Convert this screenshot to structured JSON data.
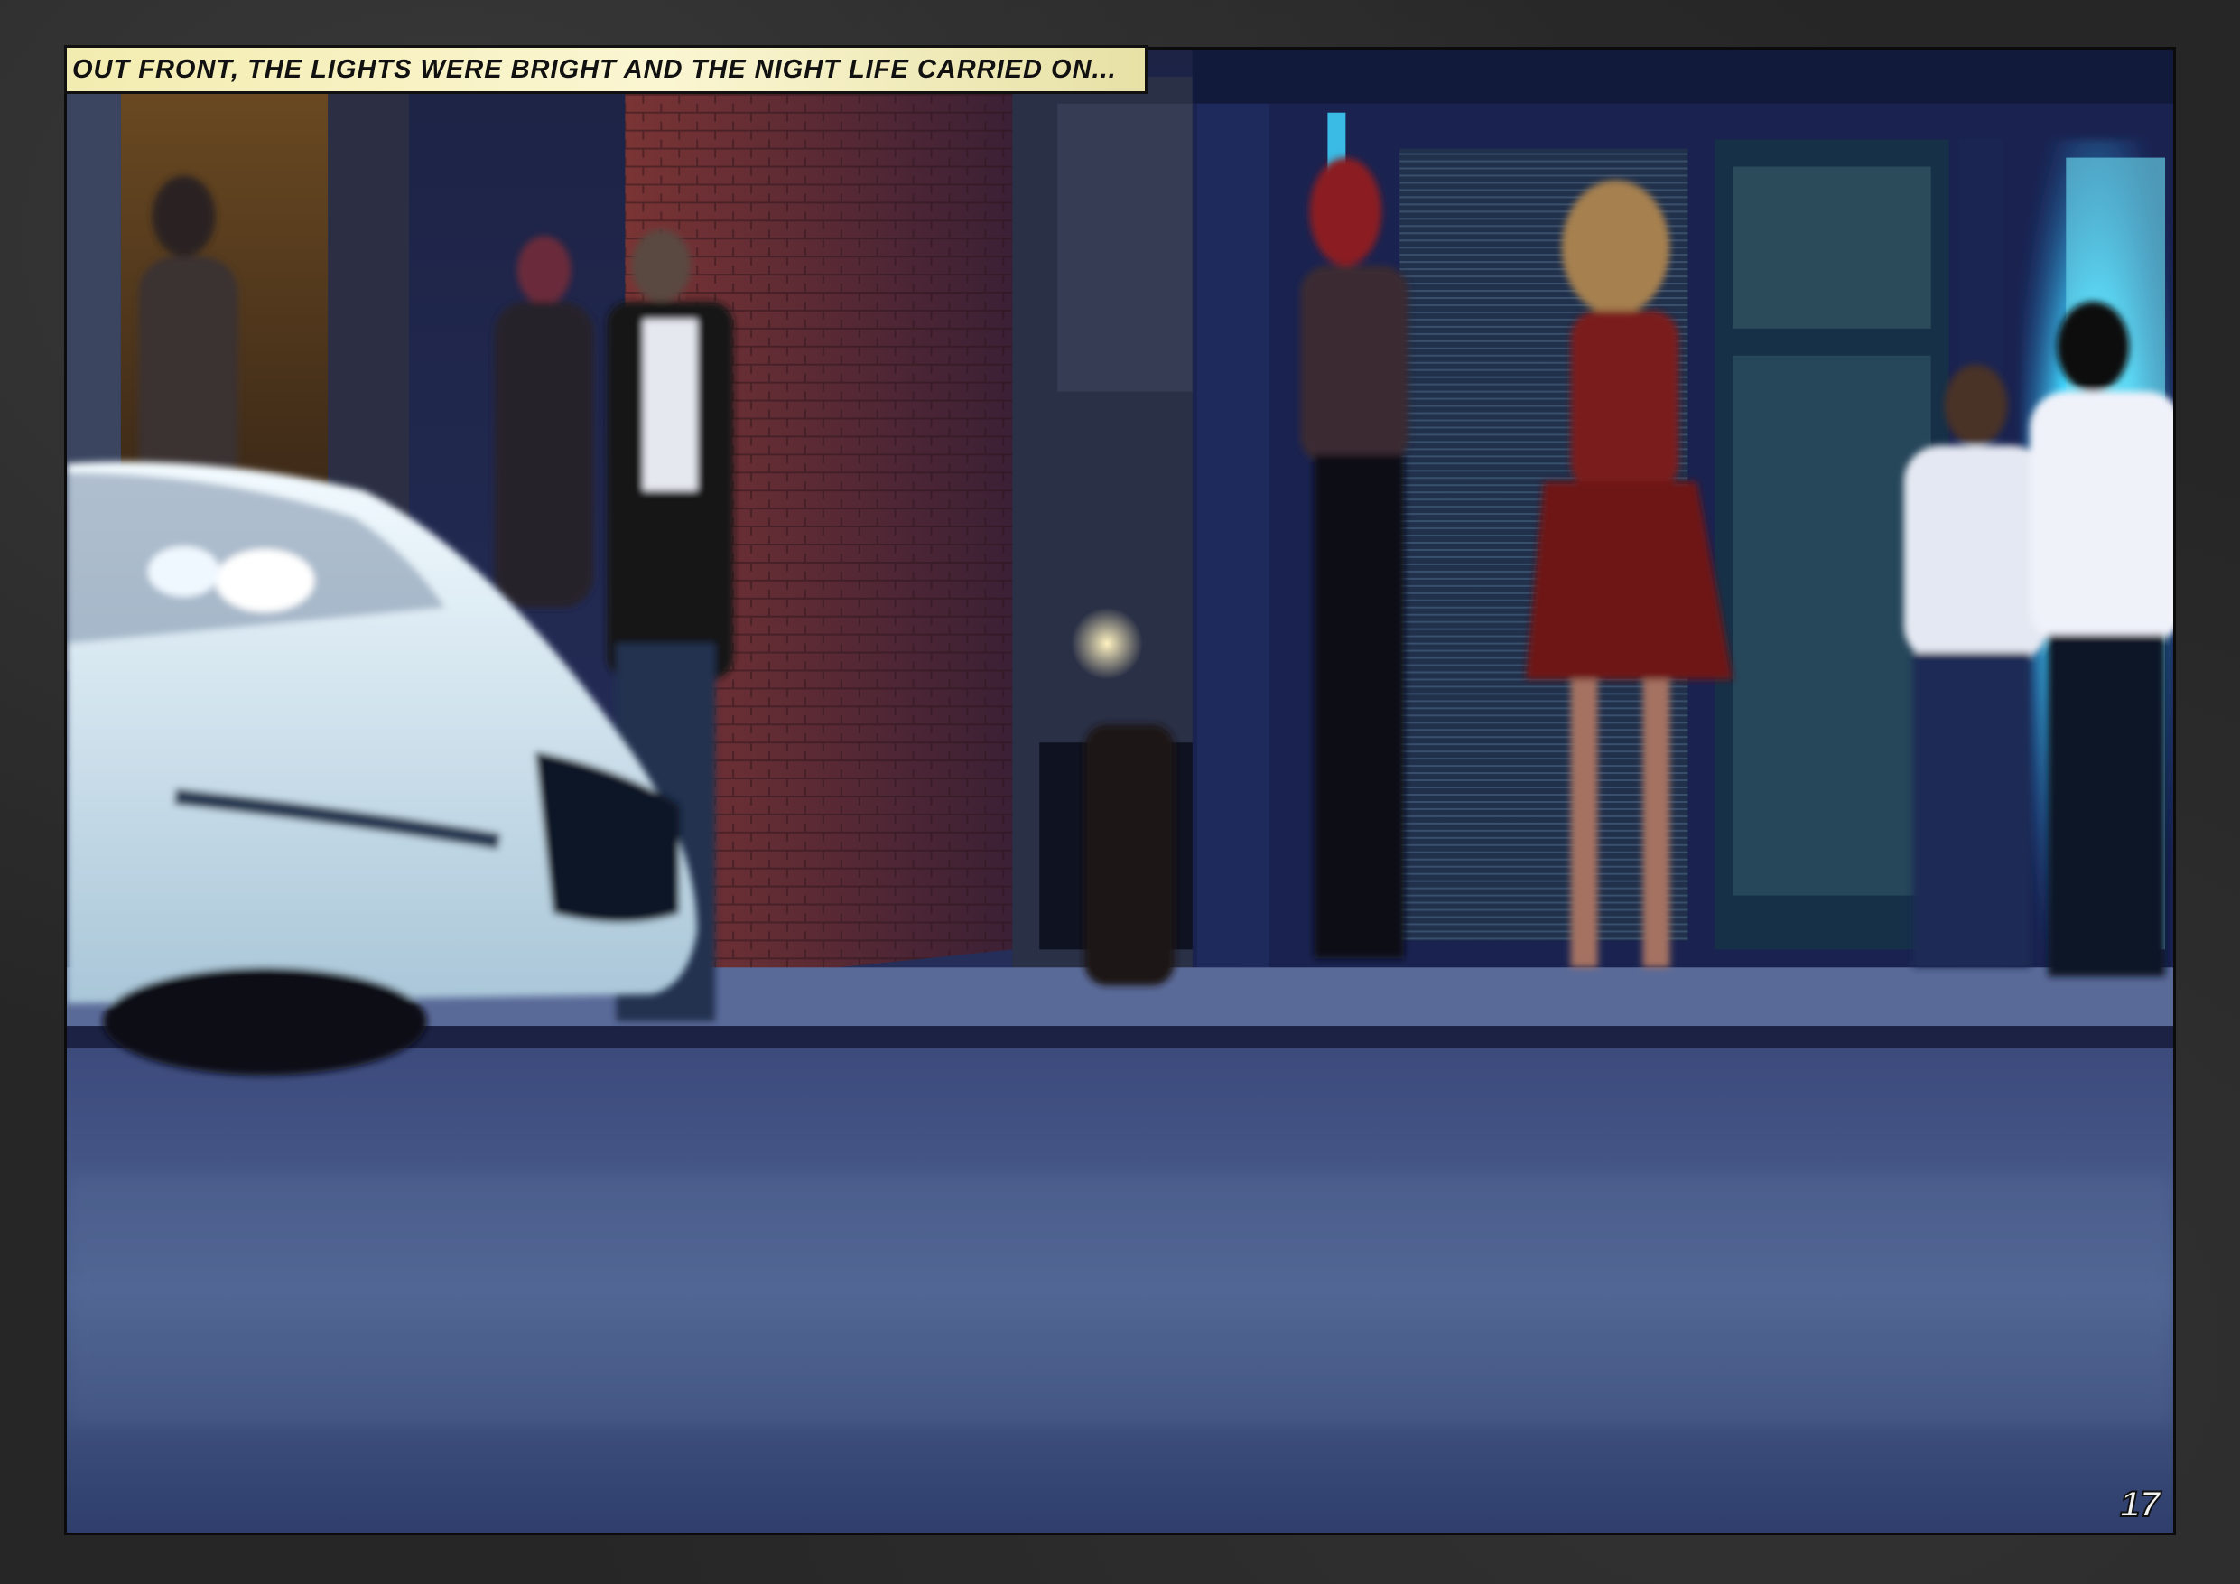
{
  "caption": {
    "text": "Out front, the lights were bright and the night life carried on..."
  },
  "page_number": "17",
  "colors": {
    "page_background": "#262626",
    "caption_fill": "#f3ecb0",
    "night_blue": "#2b3566",
    "neon_cyan": "#3fd6ff",
    "brick_red": "#7a2a2a",
    "car_white": "#dfeff5"
  }
}
